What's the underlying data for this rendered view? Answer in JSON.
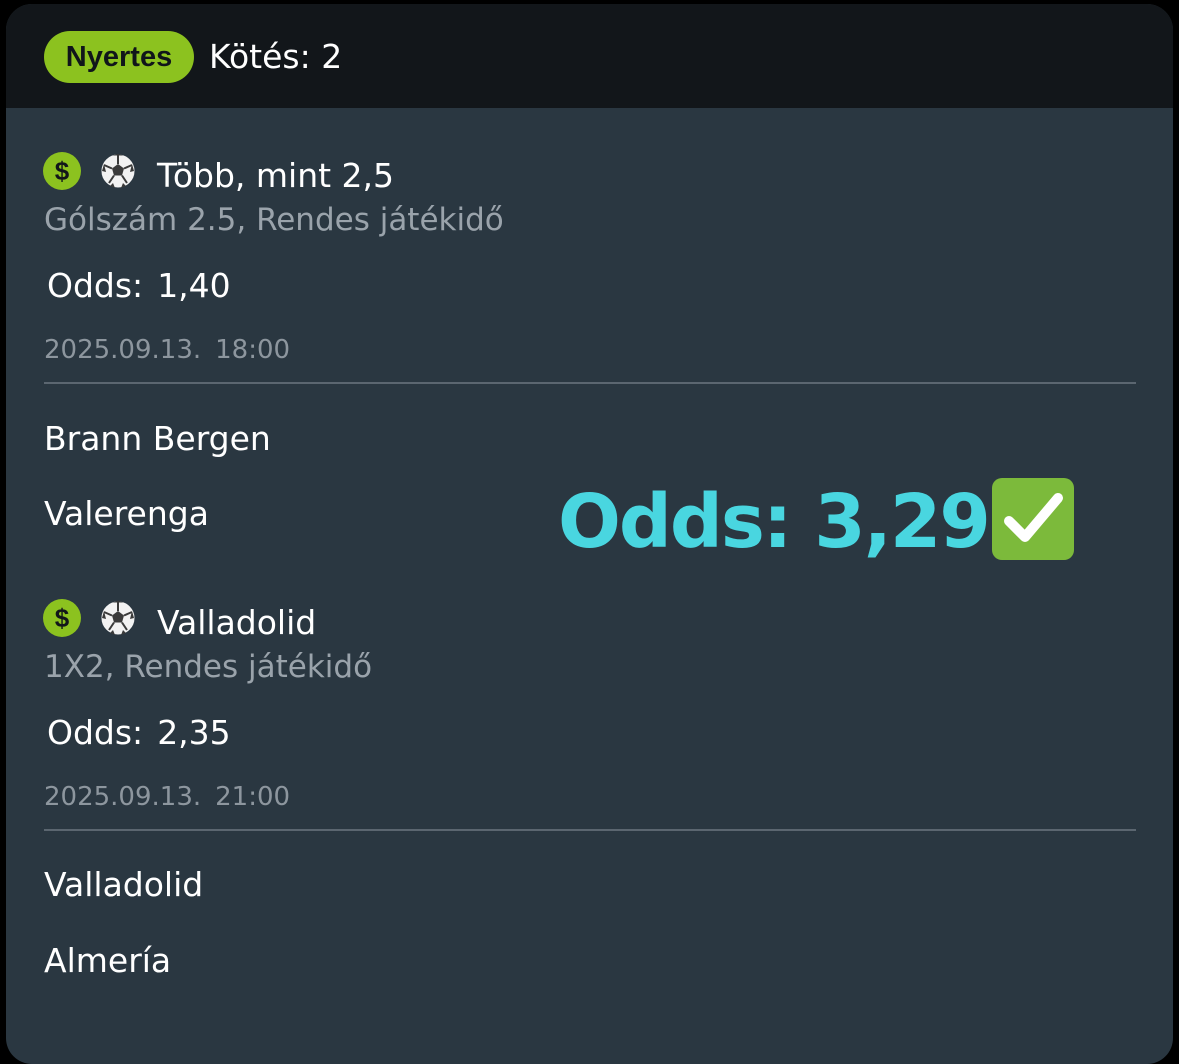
{
  "header": {
    "status_badge": "Nyertes",
    "bet_count_label": "Kötés: 2"
  },
  "selections": [
    {
      "icons": [
        "dollar-icon",
        "soccer-ball-icon"
      ],
      "title": "Több, mint 2,5",
      "market": "Gólszám 2.5, Rendes játékidő",
      "odds_label": "Odds:",
      "odds_value": "1,40",
      "date": "2025.09.13.",
      "time": "18:00",
      "home_team": "Brann Bergen",
      "away_team": "Valerenga"
    },
    {
      "icons": [
        "dollar-icon",
        "soccer-ball-icon"
      ],
      "title": "Valladolid",
      "market": "1X2, Rendes játékidő",
      "odds_label": "Odds:",
      "odds_value": "2,35",
      "date": "2025.09.13.",
      "time": "21:00",
      "home_team": "Valladolid",
      "away_team": "Almería"
    }
  ],
  "total_odds": {
    "text": "Odds: 3,29",
    "check_icon": "check-mark-button-icon"
  },
  "colors": {
    "header_bg": "#12161a",
    "card_bg": "#2a3741",
    "badge_green": "#8cc21f",
    "total_odds_cyan": "#49d6e0",
    "check_green": "#7cba3b"
  }
}
